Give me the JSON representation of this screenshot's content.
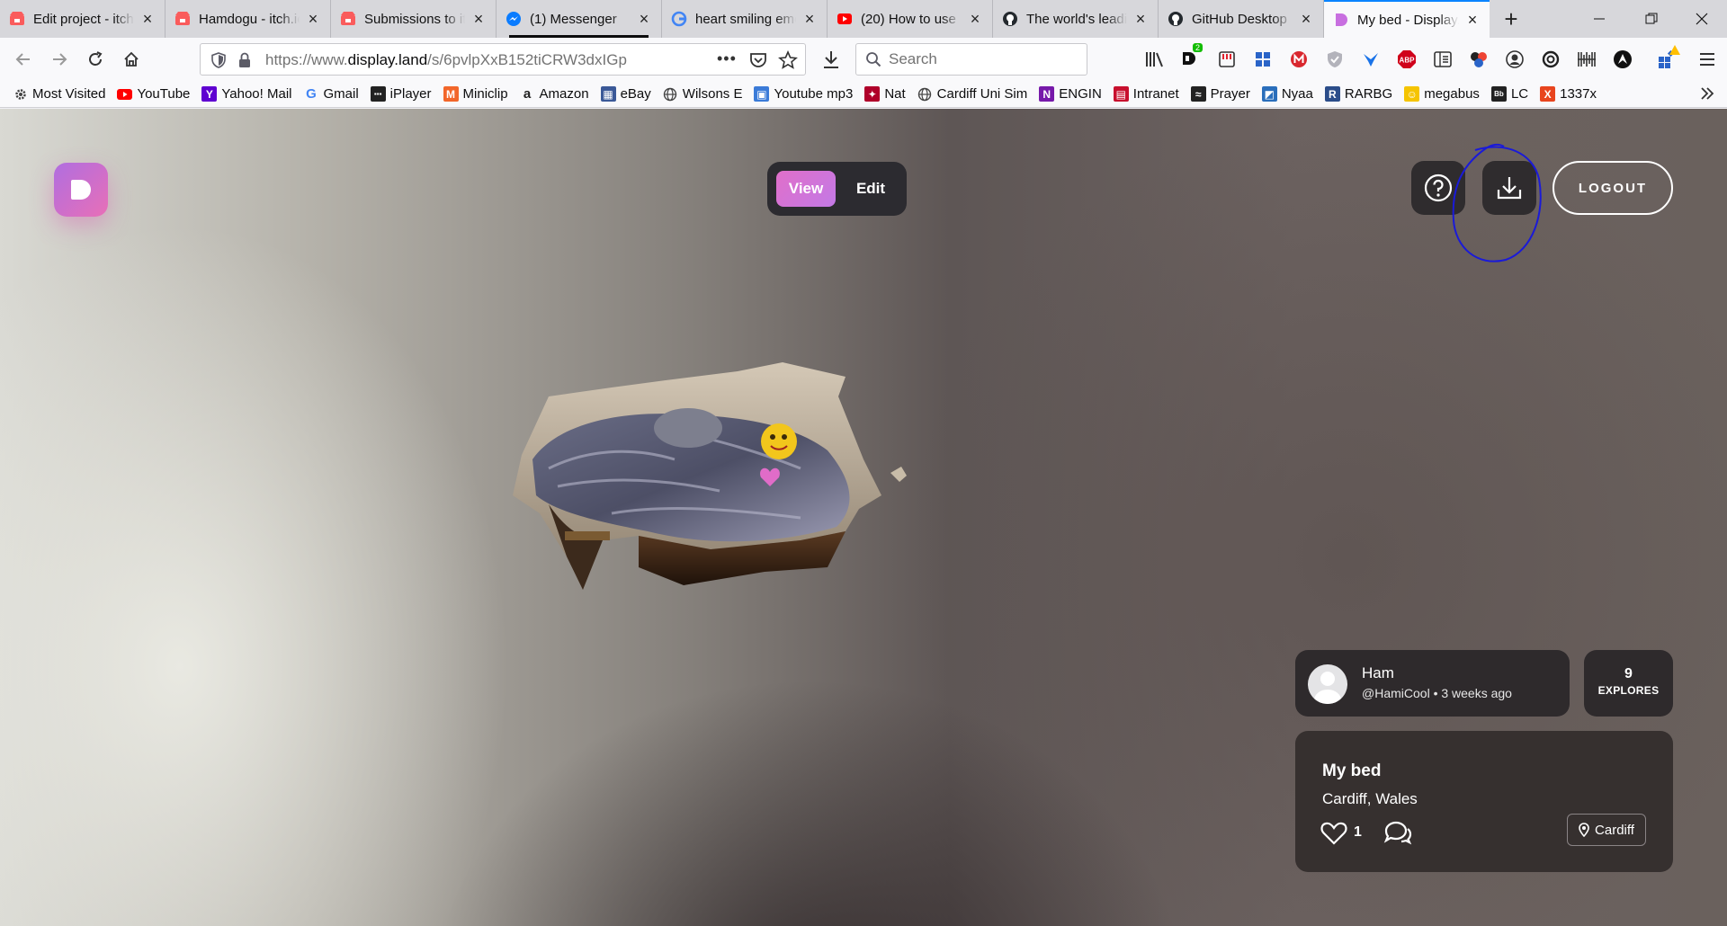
{
  "browser": {
    "tabs": [
      {
        "title": "Edit project - itch.io",
        "icon": "itch-icon",
        "color": "#fa5c5c",
        "active": false
      },
      {
        "title": "Hamdogu - itch.io",
        "icon": "itch-icon",
        "color": "#fa5c5c",
        "active": false
      },
      {
        "title": "Submissions to itch.io",
        "icon": "itch-icon",
        "color": "#fa5c5c",
        "active": false
      },
      {
        "title": "(1) Messenger",
        "icon": "messenger-icon",
        "color": "#0a7cff",
        "active": false,
        "loading": true
      },
      {
        "title": "heart smiling emoji",
        "icon": "google-icon",
        "color": "#4285f4",
        "active": false
      },
      {
        "title": "(20) How to use",
        "icon": "youtube-icon",
        "color": "#ff0000",
        "active": false
      },
      {
        "title": "The world's leading",
        "icon": "github-icon",
        "color": "#24292e",
        "active": false
      },
      {
        "title": "GitHub Desktop",
        "icon": "github-icon",
        "color": "#24292e",
        "active": false
      },
      {
        "title": "My bed - Display.land",
        "icon": "displayland-icon",
        "color": "#c86fe0",
        "active": true
      }
    ],
    "window_controls": {
      "minimize": "—",
      "restore": "❐",
      "close": "✕"
    },
    "url": {
      "prefix": "https://www.",
      "domain": "display.land",
      "path": "/s/6pvlpXxB152tiCRW3dxIGp"
    },
    "search_placeholder": "Search",
    "extension_badge": "2",
    "abp_label": "ABP",
    "bookmarks": [
      {
        "label": "Most Visited",
        "icon": "gear-icon",
        "color": "#444444"
      },
      {
        "label": "YouTube",
        "icon": "youtube-icon",
        "color": "#ff0000"
      },
      {
        "label": "Yahoo! Mail",
        "icon": "yahoo-icon",
        "color": "#5f01d1",
        "glyph": "Y"
      },
      {
        "label": "Gmail",
        "icon": "google-icon",
        "color": "#4285f4",
        "glyph": "G"
      },
      {
        "label": "iPlayer",
        "icon": "bbc-icon",
        "color": "#222222",
        "glyph": "▪▪▪"
      },
      {
        "label": "Miniclip",
        "icon": "miniclip-icon",
        "color": "#f2662a",
        "glyph": "M"
      },
      {
        "label": "Amazon",
        "icon": "amazon-icon",
        "color": "#222222",
        "glyph": "a"
      },
      {
        "label": "eBay",
        "icon": "ebay-icon",
        "color": "#3b5998",
        "glyph": "▦"
      },
      {
        "label": "Wilsons E",
        "icon": "globe-icon",
        "color": "#444444"
      },
      {
        "label": "Youtube mp3",
        "icon": "mp3-icon",
        "color": "#3b7bd8",
        "glyph": "▣"
      },
      {
        "label": "Nat",
        "icon": "nat-icon",
        "color": "#b0002a",
        "glyph": "✦"
      },
      {
        "label": "Cardiff Uni Sim",
        "icon": "globe-icon",
        "color": "#444444"
      },
      {
        "label": "ENGIN",
        "icon": "onenote-icon",
        "color": "#7719aa",
        "glyph": "N"
      },
      {
        "label": "Intranet",
        "icon": "intranet-icon",
        "color": "#c8102e",
        "glyph": "▤"
      },
      {
        "label": "Prayer",
        "icon": "salah-icon",
        "color": "#222222",
        "glyph": "≈"
      },
      {
        "label": "Nyaa",
        "icon": "nyaa-icon",
        "color": "#2a6ebb",
        "glyph": "◩"
      },
      {
        "label": "RARBG",
        "icon": "rarbg-icon",
        "color": "#2b4d8a",
        "glyph": "R"
      },
      {
        "label": "megabus",
        "icon": "megabus-icon",
        "color": "#f5c400",
        "glyph": "☺"
      },
      {
        "label": "LC",
        "icon": "blackboard-icon",
        "color": "#222222",
        "glyph": "Bb"
      },
      {
        "label": "1337x",
        "icon": "x-icon",
        "color": "#e8451e",
        "glyph": "X"
      }
    ]
  },
  "app": {
    "mode_toggle": {
      "view_label": "View",
      "edit_label": "Edit",
      "selected": "View"
    },
    "logout_label": "LOGOUT",
    "author": {
      "name": "Ham",
      "meta": "@HamiCool • 3 weeks ago"
    },
    "explores": {
      "count": "9",
      "label": "EXPLORES"
    },
    "scan": {
      "title": "My bed",
      "location": "Cardiff, Wales",
      "likes": "1",
      "place_chip": "Cardiff"
    },
    "colors": {
      "accent_gradient_start": "#e06fc9",
      "accent_gradient_end": "#c379e6",
      "panel": "#2e2a2c",
      "annotation": "#1a1ad8"
    }
  }
}
